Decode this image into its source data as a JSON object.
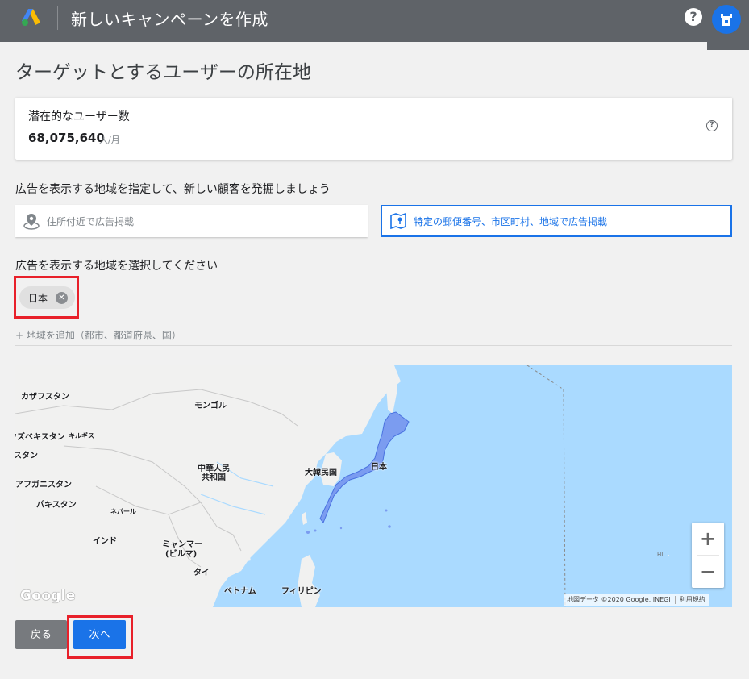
{
  "header": {
    "title": "新しいキャンペーンを作成",
    "help_label": "?"
  },
  "page": {
    "heading": "ターゲットとするユーザーの所在地"
  },
  "reach_card": {
    "label": "潜在的なユーザー数",
    "value": "68,075,640",
    "unit": "人/月",
    "help_label": "?"
  },
  "location_prompt": "広告を表示する地域を指定して、新しい顧客を発掘しましょう",
  "options": [
    {
      "label": "住所付近で広告掲載",
      "icon": "map-pin-icon"
    },
    {
      "label": "特定の郵便番号、市区町村、地域で広告掲載",
      "icon": "folded-map-icon"
    }
  ],
  "select_prompt": "広告を表示する地域を選択してください",
  "selected_chip": {
    "label": "日本",
    "remove_glyph": "✕"
  },
  "add_region_link": "+ 地域を追加（都市、都道府県、国）",
  "map": {
    "labels": {
      "kazakhstan": "カザフスタン",
      "mongolia": "モンゴル",
      "uzbekistan": "ウズベキスタン",
      "kyrgyzstan": "キルギス",
      "stan": "スタン",
      "afghanistan": "アフガニスタン",
      "pakistan": "パキスタン",
      "china_1": "中華人民",
      "china_2": "共和国",
      "nepal": "ネパール",
      "india": "インド",
      "myanmar_1": "ミャンマー",
      "myanmar_2": "(ビルマ)",
      "thailand": "タイ",
      "vietnam": "ベトナム",
      "philippines": "フィリピン",
      "korea": "大韓民国",
      "japan": "日本",
      "hawaii": "HI"
    },
    "zoom_in": "+",
    "zoom_out": "−",
    "logo_text": "Google",
    "attribution": "地図データ ©2020 Google, INEGI",
    "terms": "利用規約",
    "colors": {
      "water": "#aadaff",
      "land": "#f1f1f0",
      "highlight": "#7b9cf0"
    }
  },
  "buttons": {
    "back": "戻る",
    "next": "次へ"
  },
  "colors": {
    "accent": "#1a73e8",
    "header": "#5f6368",
    "annotation": "#e8202a"
  }
}
